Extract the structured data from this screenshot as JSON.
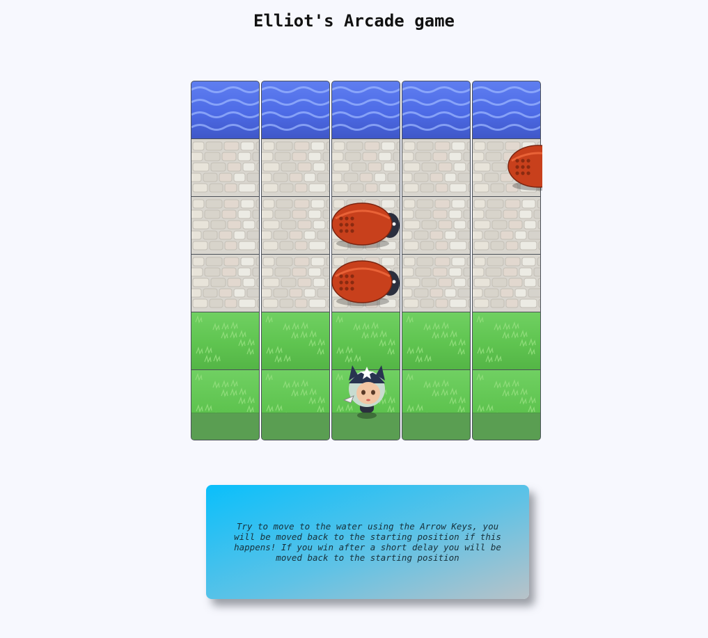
{
  "title": "Elliot's Arcade game",
  "board": {
    "columns": 5,
    "rows": [
      "water",
      "stone",
      "stone",
      "stone",
      "grass",
      "grass"
    ],
    "enemies": [
      {
        "name": "enemy-bug",
        "row": 1,
        "col": 4.5
      },
      {
        "name": "enemy-bug",
        "row": 2,
        "col": 2
      },
      {
        "name": "enemy-bug",
        "row": 3,
        "col": 2
      }
    ],
    "player": {
      "row": 5,
      "col": 2,
      "sprite": "char-cat-girl"
    }
  },
  "instructions": "Try to move to the water using the Arrow Keys, you will be moved back to the starting position if this happens! If you win after a short delay you will be moved back to the starting position",
  "colors": {
    "water": "#4d6be6",
    "stone": "#d9d6cf",
    "grass": "#5fc450",
    "bug": "#c8401c",
    "background": "#f7f8fe",
    "info_gradient_start": "#0abffb",
    "info_gradient_end": "#b8c2c8"
  }
}
